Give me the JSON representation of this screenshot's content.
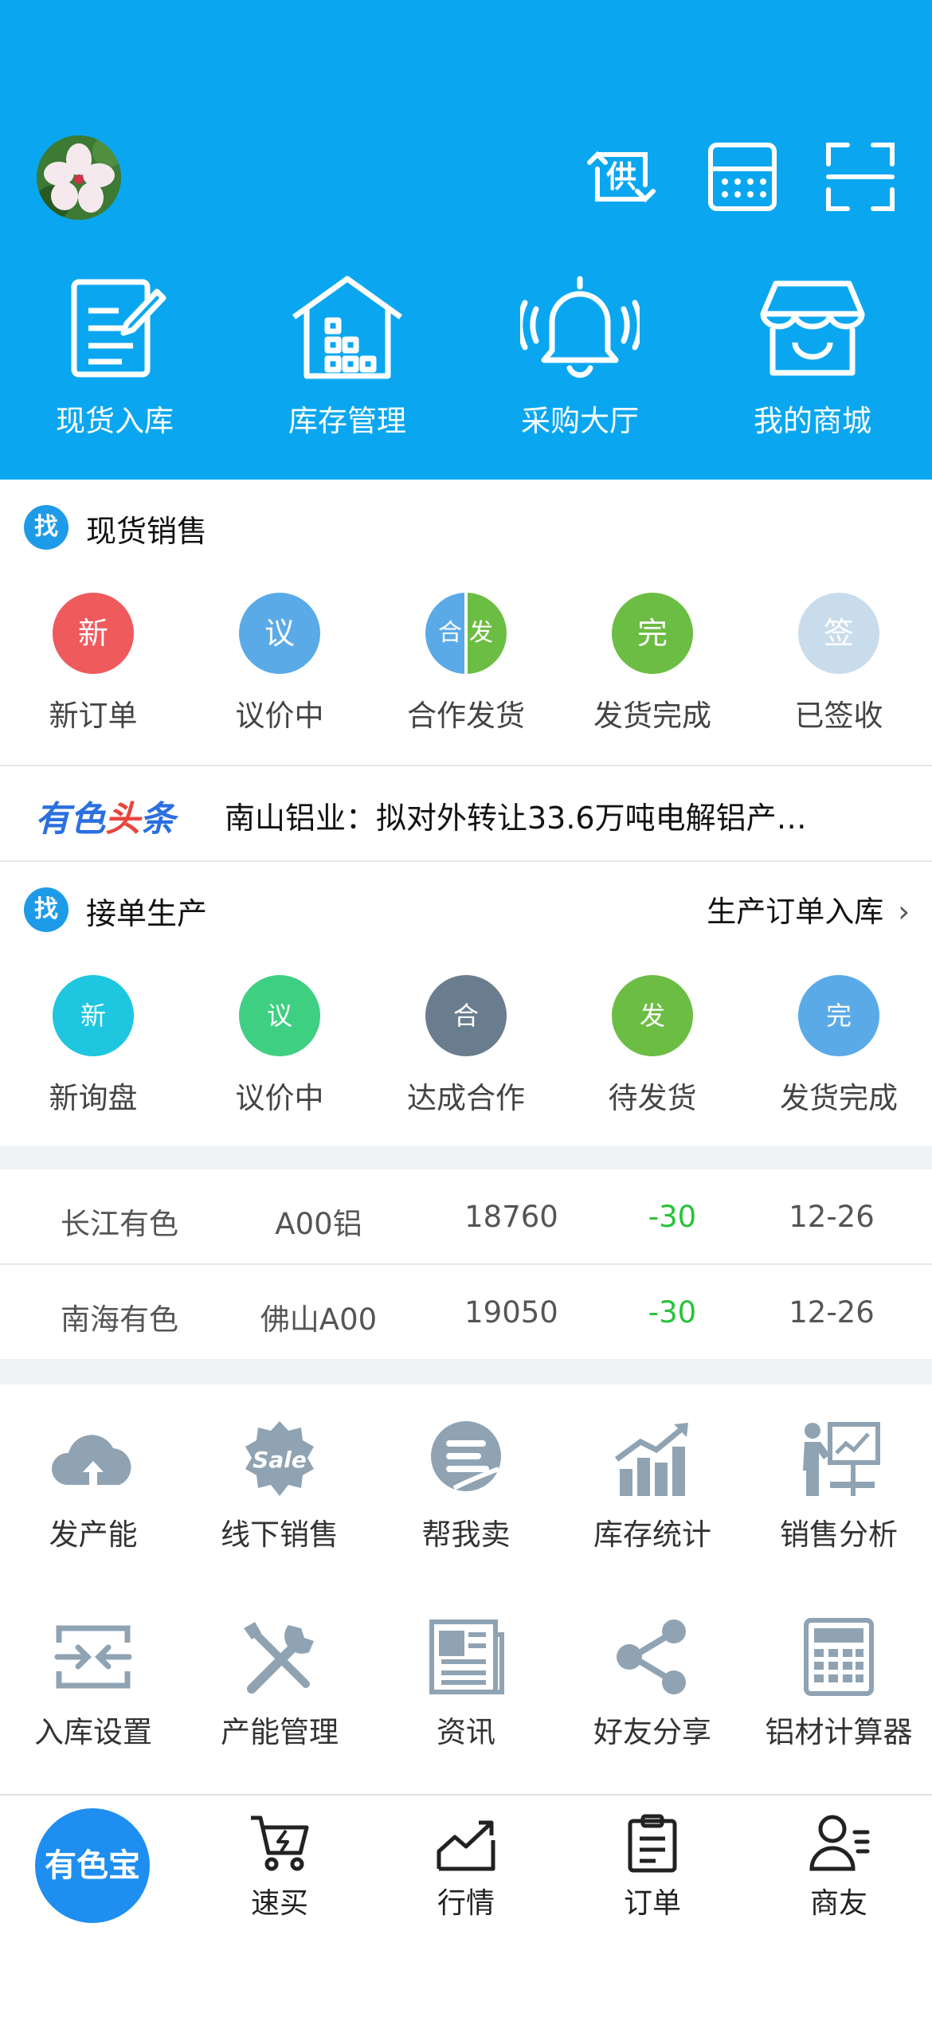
{
  "header": {
    "top_icons": [
      "supply-icon",
      "calculator-icon",
      "scan-icon"
    ],
    "supply_icon_text": "供",
    "quick_actions": [
      {
        "label": "现货入库",
        "icon": "edit-document-icon"
      },
      {
        "label": "库存管理",
        "icon": "warehouse-icon"
      },
      {
        "label": "采购大厅",
        "icon": "bell-icon"
      },
      {
        "label": "我的商城",
        "icon": "store-icon"
      }
    ]
  },
  "spot_sales": {
    "badge": "找",
    "title": "现货销售",
    "items": [
      {
        "label": "新订单",
        "glyph": "新",
        "color": "#ef5a5d"
      },
      {
        "label": "议价中",
        "glyph": "议",
        "color": "#5aaae8"
      },
      {
        "label": "合作发货",
        "glyph_left": "合",
        "glyph_right": "发",
        "color_left": "#5aaae8",
        "color_right": "#6cbd43"
      },
      {
        "label": "发货完成",
        "glyph": "完",
        "color": "#6cbd43"
      },
      {
        "label": "已签收",
        "glyph": "签",
        "color": "#c9dcec"
      }
    ]
  },
  "headline": {
    "brand_part1": "有色",
    "brand_part2": "头",
    "brand_part3": "条",
    "text": "南山铝业：拟对外转让33.6万吨电解铝产…"
  },
  "production": {
    "badge": "找",
    "title": "接单生产",
    "link": "生产订单入库",
    "link_chevron": "›",
    "items": [
      {
        "label": "新询盘",
        "glyph": "新",
        "color": "#1ec6df"
      },
      {
        "label": "议价中",
        "glyph": "议",
        "color": "#3fcf83"
      },
      {
        "label": "达成合作",
        "glyph": "合",
        "color": "#6a7d8e"
      },
      {
        "label": "待发货",
        "glyph": "发",
        "color": "#6cbd43"
      },
      {
        "label": "发货完成",
        "glyph": "完",
        "color": "#5aaae8"
      }
    ]
  },
  "prices": {
    "change_color": "#27c33a",
    "rows": [
      {
        "market": "长江有色",
        "product": "A00铝",
        "price": "18760",
        "change": "-30",
        "date": "12-26"
      },
      {
        "market": "南海有色",
        "product": "佛山A00",
        "price": "19050",
        "change": "-30",
        "date": "12-26"
      }
    ]
  },
  "tools": [
    {
      "label": "发产能",
      "icon": "cloud-upload-icon"
    },
    {
      "label": "线下销售",
      "icon": "sale-badge-icon",
      "badge_text": "Sale"
    },
    {
      "label": "帮我卖",
      "icon": "helper-sell-icon"
    },
    {
      "label": "库存统计",
      "icon": "bar-chart-icon"
    },
    {
      "label": "销售分析",
      "icon": "presentation-icon"
    },
    {
      "label": "入库设置",
      "icon": "inbound-settings-icon"
    },
    {
      "label": "产能管理",
      "icon": "tools-icon"
    },
    {
      "label": "资讯",
      "icon": "newspaper-icon"
    },
    {
      "label": "好友分享",
      "icon": "share-icon"
    },
    {
      "label": "铝材计算器",
      "icon": "calculator-icon"
    }
  ],
  "tabbar": {
    "main": "有色宝",
    "tabs": [
      {
        "label": "速买",
        "icon": "cart-icon"
      },
      {
        "label": "行情",
        "icon": "trend-chart-icon"
      },
      {
        "label": "订单",
        "icon": "clipboard-icon"
      },
      {
        "label": "商友",
        "icon": "contacts-icon"
      }
    ]
  },
  "colors": {
    "header_bg": "#0aa7f0",
    "icon_gray": "#8fa3b3",
    "brand_blue": "#2b6fe0",
    "brand_red": "#e8453c"
  }
}
